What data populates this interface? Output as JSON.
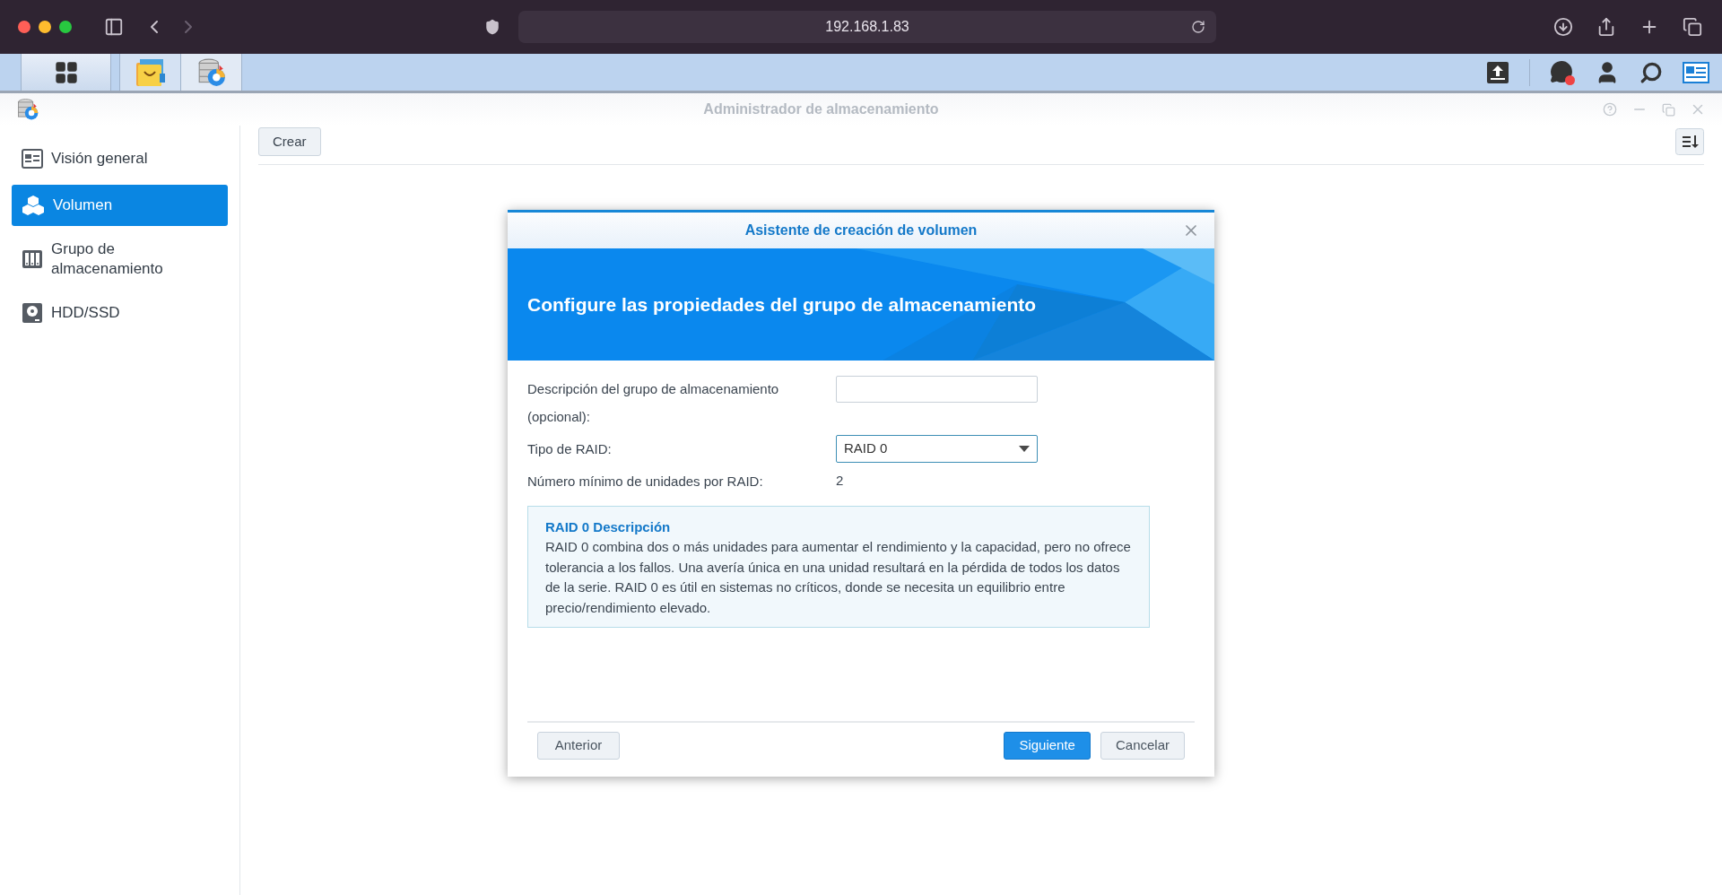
{
  "browser": {
    "address": "192.168.1.83"
  },
  "window": {
    "title": "Administrador de almacenamiento"
  },
  "sidebar": {
    "items": [
      {
        "label": "Visión general",
        "kind": "overview",
        "selected": false
      },
      {
        "label": "Volumen",
        "kind": "volume",
        "selected": true
      },
      {
        "label": "Grupo de almacenamiento",
        "kind": "pool",
        "selected": false
      },
      {
        "label": "HDD/SSD",
        "kind": "disk",
        "selected": false
      }
    ]
  },
  "toolbar": {
    "buttons": [
      "Crear"
    ]
  },
  "dialog": {
    "title": "Asistente de creación de volumen",
    "heading": "Configure las propiedades del grupo de almacenamiento",
    "fields": [
      {
        "label": "Descripción del grupo de almacenamiento (opcional):",
        "kind": "text"
      },
      {
        "label": "Tipo de RAID:",
        "kind": "select",
        "value": "RAID 0"
      },
      {
        "label": "Número mínimo de unidades por RAID:",
        "kind": "static",
        "value": "2"
      }
    ],
    "info": {
      "title": "RAID 0 Descripción",
      "text": "RAID 0 combina dos o más unidades para aumentar el rendimiento y la capacidad, pero no ofrece tolerancia a los fallos. Una avería única en una unidad resultará en la pérdida de todos los datos de la serie. RAID 0 es útil en sistemas no críticos, donde se necesita un equilibrio entre precio/rendimiento elevado."
    },
    "footer": {
      "left_buttons": [
        {
          "label": "Anterior",
          "kind": "secondary"
        }
      ],
      "right_buttons": [
        {
          "label": "Siguiente",
          "kind": "primary"
        },
        {
          "label": "Cancelar",
          "kind": "secondary"
        }
      ]
    }
  }
}
